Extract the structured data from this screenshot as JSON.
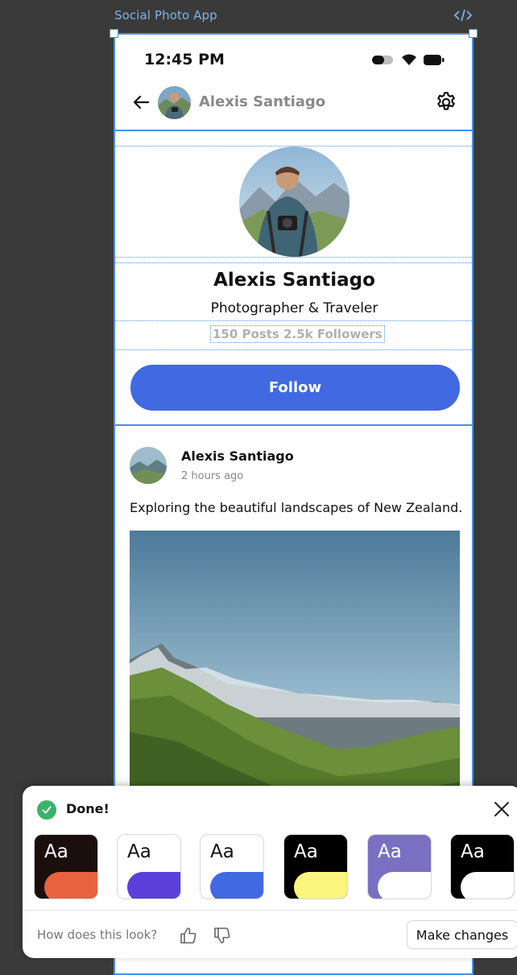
{
  "canvas": {
    "frame_label": "Social Photo App"
  },
  "status_bar": {
    "time": "12:45 PM"
  },
  "topbar": {
    "name": "Alexis Santiago"
  },
  "profile": {
    "name": "Alexis Santiago",
    "bio": "Photographer & Traveler",
    "stats": "150 Posts  2.5k Followers",
    "follow_label": "Follow"
  },
  "post": {
    "author": "Alexis Santiago",
    "time": "2 hours ago",
    "caption": "Exploring the beautiful landscapes of New Zealand."
  },
  "feedback": {
    "done_label": "Done!",
    "question": "How does this look?",
    "make_changes_label": "Make changes",
    "themes": [
      {
        "label": "Aa",
        "bg": "#1a0f0d",
        "text": "#ffffff",
        "accent": "#e8623f"
      },
      {
        "label": "Aa",
        "bg": "#ffffff",
        "text": "#111111",
        "accent": "#5a3fd8"
      },
      {
        "label": "Aa",
        "bg": "#ffffff",
        "text": "#111111",
        "accent": "#4169e1"
      },
      {
        "label": "Aa",
        "bg": "#000000",
        "text": "#ffffff",
        "accent": "#fbf57e"
      },
      {
        "label": "Aa",
        "bg": "#7b6fc2",
        "text": "#ffffff",
        "accent": "#ffffff"
      },
      {
        "label": "Aa",
        "bg": "#000000",
        "text": "#ffffff",
        "accent": "#ffffff"
      }
    ]
  },
  "colors": {
    "accent_blue": "#4169e1",
    "selection_blue": "#4a90e2",
    "success_green": "#3bb26b"
  }
}
